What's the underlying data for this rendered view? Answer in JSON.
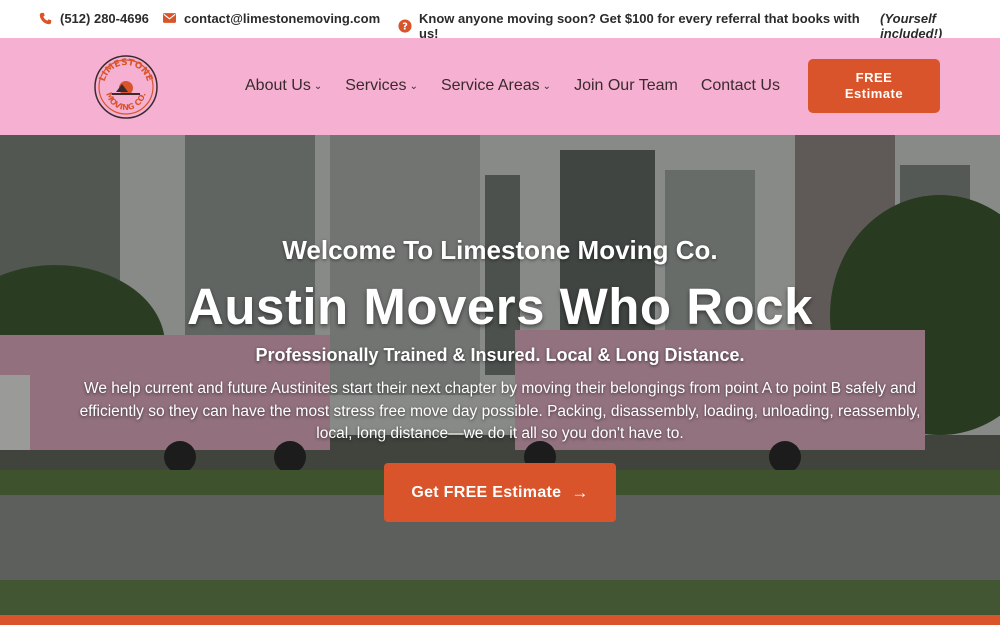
{
  "topbar": {
    "phone": "(512) 280-4696",
    "email": "contact@limestonemoving.com",
    "promo_text": "Know anyone moving soon? Get $100 for every referral that books with us!",
    "promo_emphasis": "(Yourself included!)"
  },
  "brand": {
    "logo_top": "LIMESTONE",
    "logo_bottom": "MOVING CO."
  },
  "nav": {
    "items": [
      {
        "label": "About Us",
        "dropdown": true
      },
      {
        "label": "Services",
        "dropdown": true
      },
      {
        "label": "Service Areas",
        "dropdown": true
      },
      {
        "label": "Join Our Team",
        "dropdown": false
      },
      {
        "label": "Contact Us",
        "dropdown": false
      }
    ],
    "estimate_line1": "FREE",
    "estimate_line2": "Estimate"
  },
  "hero": {
    "welcome": "Welcome To Limestone Moving Co.",
    "headline": "Austin Movers Who Rock",
    "subhead": "Professionally Trained & Insured. Local & Long Distance.",
    "description": "We help current and future Austinites start their next chapter by moving their belongings from point A to point B safely and efficiently so they can have the most stress free move day possible. Packing, disassembly, loading, unloading, reassembly, local, long distance—we do it all so you don't have to.",
    "cta_label": "Get FREE Estimate"
  },
  "colors": {
    "accent": "#d9542a",
    "header_bg": "#f6b1d2"
  }
}
